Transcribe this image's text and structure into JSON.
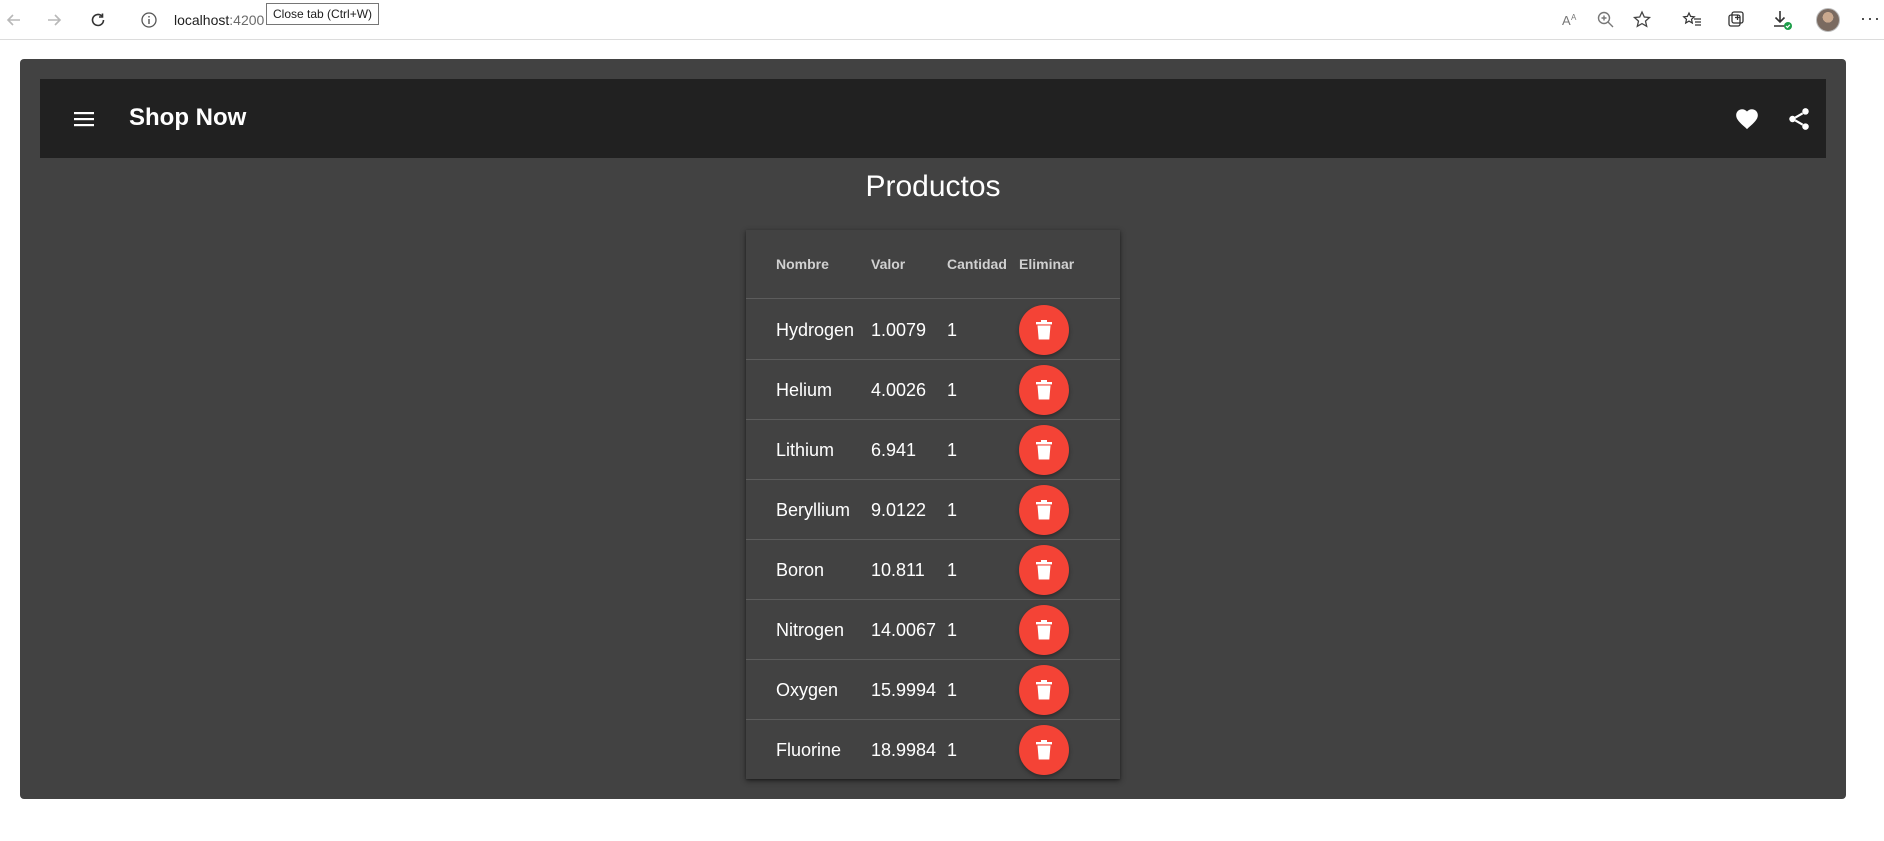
{
  "browser": {
    "url_host": "localhost",
    "url_port": ":4200",
    "tooltip": "Close tab (Ctrl+W)"
  },
  "toolbar": {
    "title": "Shop Now"
  },
  "page": {
    "title": "Productos"
  },
  "table": {
    "headers": [
      "Nombre",
      "Valor",
      "Cantidad",
      "Eliminar"
    ],
    "rows": [
      {
        "nombre": "Hydrogen",
        "valor": "1.0079",
        "cantidad": "1"
      },
      {
        "nombre": "Helium",
        "valor": "4.0026",
        "cantidad": "1"
      },
      {
        "nombre": "Lithium",
        "valor": "6.941",
        "cantidad": "1"
      },
      {
        "nombre": "Beryllium",
        "valor": "9.0122",
        "cantidad": "1"
      },
      {
        "nombre": "Boron",
        "valor": "10.811",
        "cantidad": "1"
      },
      {
        "nombre": "Nitrogen",
        "valor": "14.0067",
        "cantidad": "1"
      },
      {
        "nombre": "Oxygen",
        "valor": "15.9994",
        "cantidad": "1"
      },
      {
        "nombre": "Fluorine",
        "valor": "18.9984",
        "cantidad": "1"
      }
    ]
  },
  "colors": {
    "toolbar": "#212121",
    "background": "#424242",
    "delete_button": "#f44336"
  },
  "icons": {
    "back": "arrow-left-icon",
    "forward": "arrow-right-icon",
    "reload": "reload-icon",
    "menu": "menu-icon",
    "favorite": "heart-icon",
    "share": "share-icon",
    "delete": "trash-icon"
  }
}
